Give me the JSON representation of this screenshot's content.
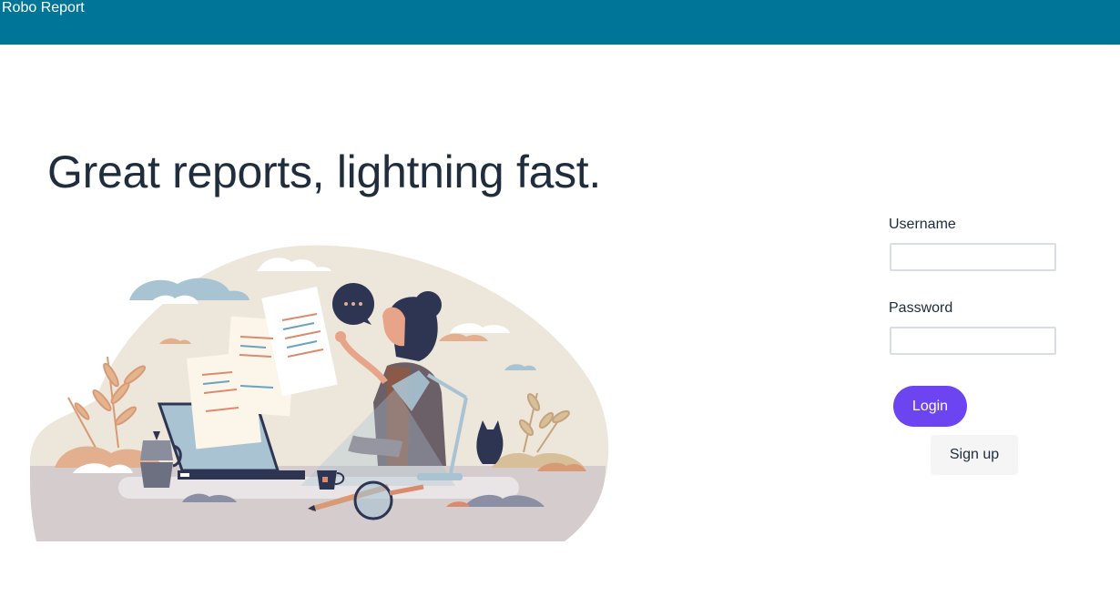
{
  "header": {
    "brand": "Robo Report",
    "background": "#017597"
  },
  "hero": {
    "headline": "Great reports, lightning fast."
  },
  "login": {
    "username_label": "Username",
    "username_value": "",
    "password_label": "Password",
    "password_value": "",
    "login_label": "Login",
    "signup_label": "Sign up",
    "accent": "#6c44f0"
  },
  "illustration": {
    "icon": "woman-writing-reports-illustration"
  }
}
